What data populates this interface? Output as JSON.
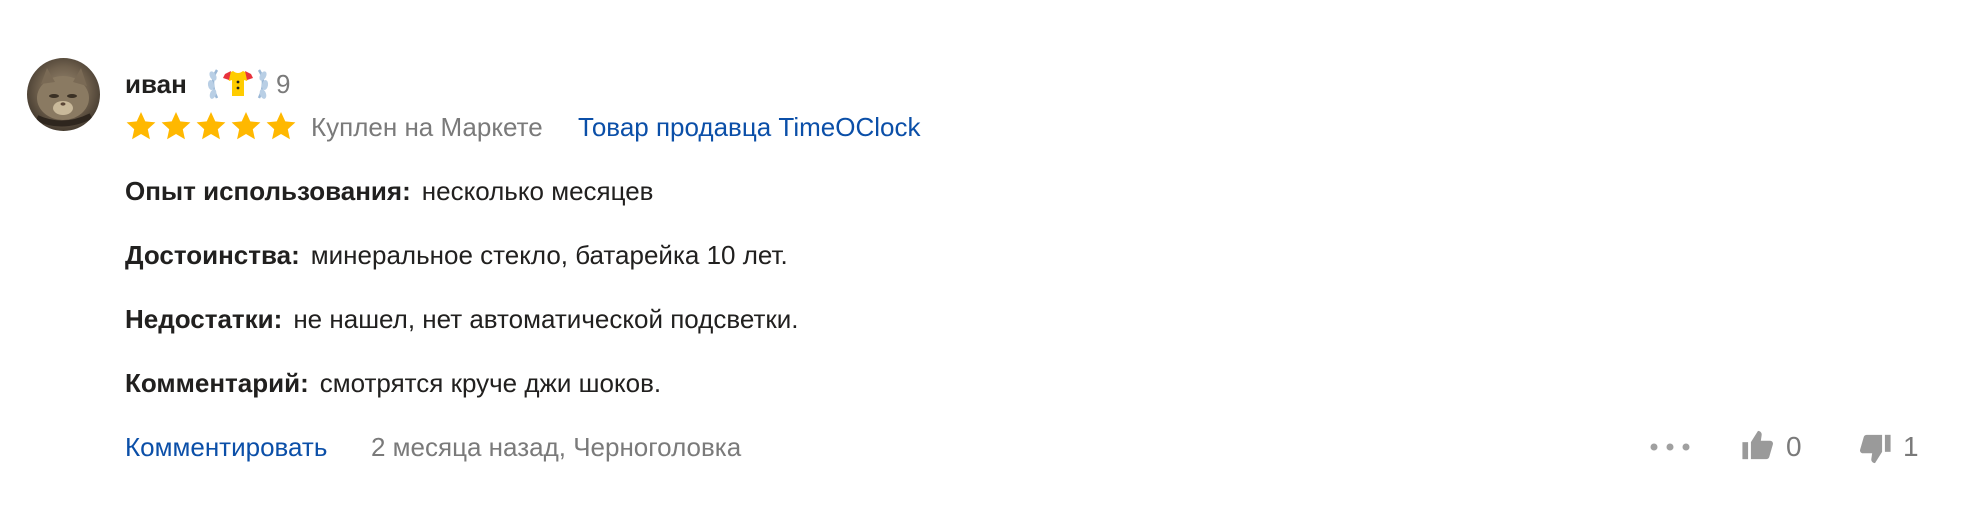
{
  "review": {
    "author": {
      "name": "иван",
      "badge_icon": "achievement-laurel-badge-icon",
      "badge_count": "9"
    },
    "rating": {
      "stars": 5,
      "max": 5,
      "color": "#ffb800"
    },
    "purchase_info": "Куплен на Маркете",
    "seller_link": "Товар продавца TimeOClock",
    "fields": [
      {
        "label": "Опыт использования:",
        "value": "несколько месяцев"
      },
      {
        "label": "Достоинства:",
        "value": "минеральное стекло, батарейка 10 лет."
      },
      {
        "label": "Недостатки:",
        "value": "не нашел, нет автоматической подсветки."
      },
      {
        "label": "Комментарий:",
        "value": "смотрятся круче джи шоков."
      }
    ],
    "footer": {
      "comment_link": "Комментировать",
      "meta": "2 месяца назад, Черноголовка",
      "likes": "0",
      "dislikes": "1"
    }
  },
  "colors": {
    "link": "#0b4fa8",
    "muted": "#7a7a7a",
    "text": "#21201f",
    "star": "#ffb800"
  }
}
